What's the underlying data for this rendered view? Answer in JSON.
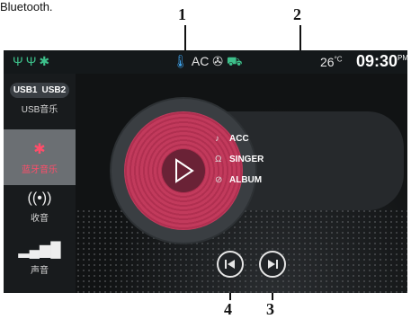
{
  "caption": {
    "text": "Bluetooth."
  },
  "callouts": [
    "1",
    "2",
    "3",
    "4"
  ],
  "statusbar": {
    "left_icons": [
      "usb-icon",
      "usb-icon",
      "bluetooth-icon"
    ],
    "thermo_icon": "thermometer-icon",
    "ac_label": "AC",
    "temperature": "26",
    "temp_unit": "°C",
    "time": "09:30",
    "ampm": "PM"
  },
  "sidebar": {
    "items": [
      {
        "tag1": "USB1",
        "tag2": "USB2",
        "label": "USB音乐"
      },
      {
        "icon": "bluetooth-icon",
        "label": "蓝牙音乐"
      },
      {
        "icon": "radio-icon",
        "label": "收音"
      },
      {
        "icon": "sound-bars-icon",
        "label": "声音"
      }
    ]
  },
  "track": {
    "artist_tag": "ACC",
    "singer": "SINGER",
    "album": "ALBUM"
  },
  "colors": {
    "accent_red": "#c23a5c",
    "green": "#3dbf8a",
    "background": "#101214"
  }
}
